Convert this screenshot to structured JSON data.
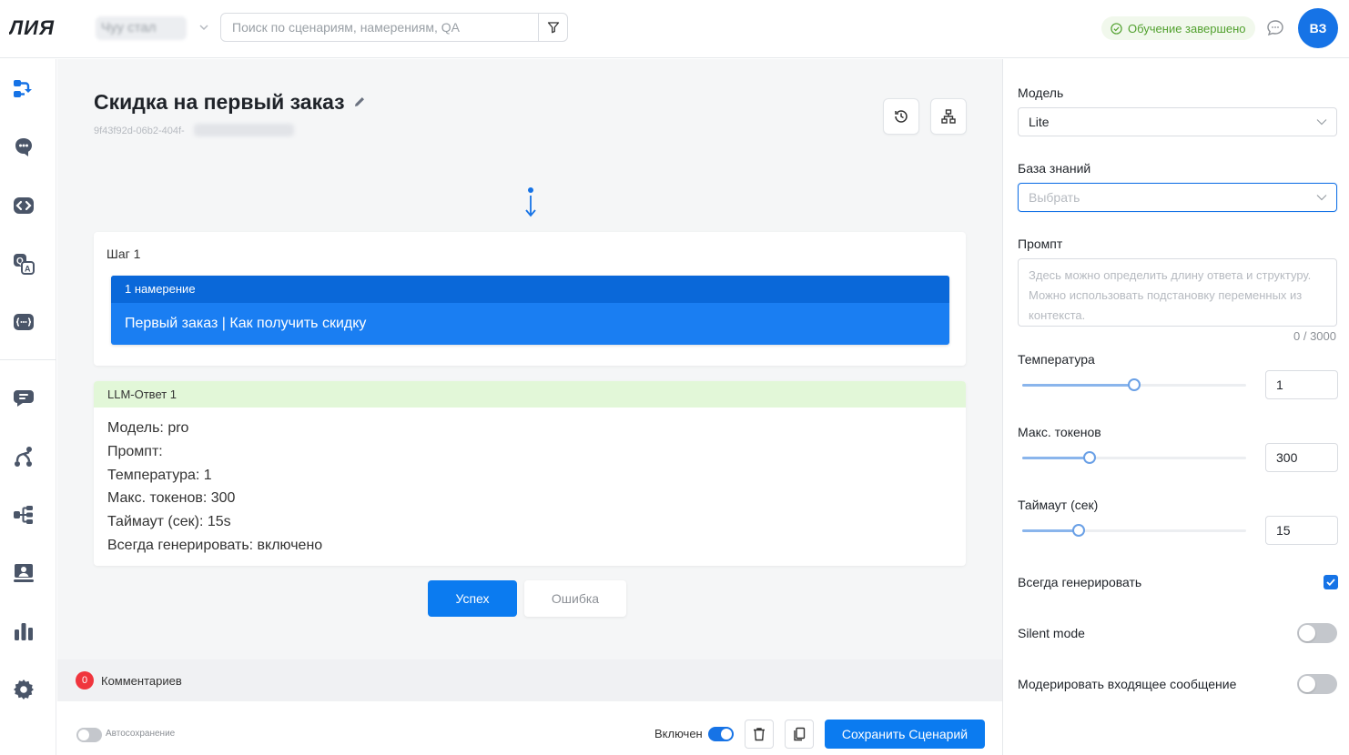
{
  "header": {
    "logo_text": "ЛИЯ",
    "project_name": "Чуу стал",
    "search_placeholder": "Поиск по сценариям, намерениям, QA",
    "status_text": "Обучение завершено",
    "avatar_initials": "ВЗ"
  },
  "sidebar": {
    "items": [
      {
        "icon": "scenarios-icon",
        "active": true
      },
      {
        "icon": "intents-icon"
      },
      {
        "icon": "code-icon"
      },
      {
        "icon": "qa-translate-icon"
      },
      {
        "icon": "variables-icon"
      },
      {
        "icon": "chat-history-icon"
      },
      {
        "icon": "flow-icon"
      },
      {
        "icon": "hierarchy-icon"
      },
      {
        "icon": "training-icon"
      },
      {
        "icon": "analytics-icon"
      },
      {
        "icon": "settings-icon"
      }
    ]
  },
  "scenario": {
    "title": "Скидка на первый заказ",
    "id_prefix": "9f43f92d-06b2-404f-"
  },
  "step": {
    "label": "Шаг 1",
    "intent_header": "1 намерение",
    "intent_text": "Первый заказ | Как получить скидку"
  },
  "llm": {
    "header": "LLM-Ответ 1",
    "lines": [
      "Модель: pro",
      "Промпт:",
      "Температура: 1",
      "Макс. токенов: 300",
      "Таймаут (сек): 15s",
      "Всегда генерировать: включено"
    ]
  },
  "buttons": {
    "success": "Успех",
    "error": "Ошибка"
  },
  "comments": {
    "count": "0",
    "label": "Комментариев"
  },
  "footer": {
    "autosave_label": "Автосохранение",
    "autosave_on": false,
    "enabled_label": "Включен",
    "enabled_on": true,
    "save_label": "Сохранить Сценарий"
  },
  "panel": {
    "model_label": "Модель",
    "model_value": "Lite",
    "kb_label": "База знаний",
    "kb_placeholder": "Выбрать",
    "prompt_label": "Промпт",
    "prompt_placeholder": "Здесь можно определить длину ответа и структуру. Можно использовать подстановку переменных из контекста.",
    "prompt_counter": "0 / 3000",
    "temperature_label": "Температура",
    "temperature_value": "1",
    "temperature_fraction": 0.5,
    "tokens_label": "Макс. токенов",
    "tokens_value": "300",
    "tokens_fraction": 0.3,
    "timeout_label": "Таймаут (сек)",
    "timeout_value": "15",
    "timeout_fraction": 0.25,
    "always_generate_label": "Всегда генерировать",
    "always_generate_checked": true,
    "silent_label": "Silent mode",
    "silent_on": false,
    "moderate_label": "Модерировать входящее сообщение",
    "moderate_on": false
  },
  "colors": {
    "accent": "#0b7bf0",
    "intent_blue": "#1a7ef2",
    "llm_header_green": "#e2f7d8",
    "status_green": "#52a12f",
    "badge_red": "#f0353d"
  }
}
